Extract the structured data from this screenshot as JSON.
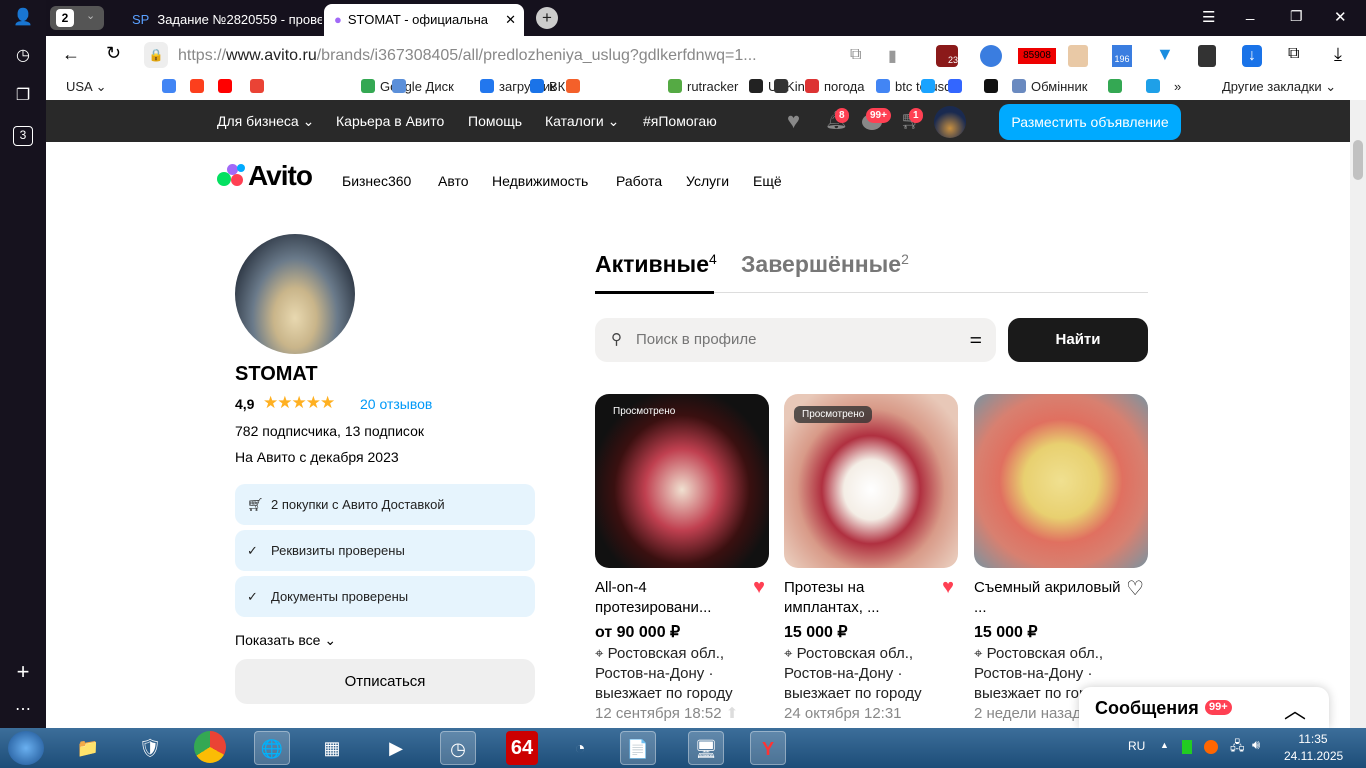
{
  "browser": {
    "tab_count": "2",
    "tabs": [
      {
        "label": "Задание №2820559 - проверка"
      },
      {
        "label": "STOMAT - официальная страница"
      }
    ],
    "url_prefix": "https://",
    "url_domain": "www.avito.ru",
    "url_path": "/brands/i367308405/all/predlozheniya_uslug?gdlkerfdnwq=1...",
    "extension_badges": [
      "23",
      "85908",
      "196"
    ],
    "sidebar_badge": "3",
    "bookmarks": [
      {
        "label": "USA",
        "color": "#fff"
      },
      {
        "label": "",
        "color": "#4285f4"
      },
      {
        "label": "",
        "color": "#fc3f1d"
      },
      {
        "label": "",
        "color": "#ff0000"
      },
      {
        "label": "",
        "color": "#ea4335"
      },
      {
        "label": "Google Диск",
        "color": "#34a853"
      },
      {
        "label": "",
        "color": "#5b8fd9"
      },
      {
        "label": "загрузчик",
        "color": "#2277ee"
      },
      {
        "label": "ВК",
        "color": "#1a73e8"
      },
      {
        "label": "",
        "color": "#f4602a"
      },
      {
        "label": "rutracker",
        "color": "#5a4"
      },
      {
        "label": "UAKino",
        "color": "#222"
      },
      {
        "label": "",
        "color": "#333"
      },
      {
        "label": "погода",
        "color": "#d33"
      },
      {
        "label": "btc to usd",
        "color": "#4285f4"
      },
      {
        "label": "",
        "color": "#1aa3ff"
      },
      {
        "label": "",
        "color": "#3366ff"
      },
      {
        "label": "",
        "color": "#111"
      },
      {
        "label": "Обмінник",
        "color": "#6a8ac0"
      },
      {
        "label": "",
        "color": "#34a853"
      },
      {
        "label": "",
        "color": "#1ea0e8"
      }
    ],
    "more_bookmarks": "»",
    "other_bookmarks": "Другие закладки"
  },
  "avito_header": {
    "nav": [
      "Для бизнеса",
      "Карьера в Авито",
      "Помощь",
      "Каталоги",
      "#яПомогаю"
    ],
    "notifications_badge": "8",
    "messages_badge": "99+",
    "cart_badge": "1",
    "post_button": "Разместить объявление",
    "logo": "Avito",
    "main_nav": [
      "Бизнес360",
      "Авто",
      "Недвижимость",
      "Работа",
      "Услуги",
      "Ещё"
    ],
    "accent": "#00aaff"
  },
  "profile": {
    "name": "STOMAT",
    "rating": "4,9",
    "stars": 5,
    "reviews": "20 отзывов",
    "followers": "782 подписчика, 13 подписок",
    "since": "На Авито с декабря 2023",
    "badges": [
      "2 покупки с Авито Доставкой",
      "Реквизиты проверены",
      "Документы проверены"
    ],
    "show_all": "Показать все",
    "unsubscribe": "Отписаться"
  },
  "listings": {
    "tabs": [
      {
        "label": "Активные",
        "count": "4"
      },
      {
        "label": "Завершённые",
        "count": "2"
      }
    ],
    "search_placeholder": "Поиск в профиле",
    "search_button": "Найти",
    "seen_label": "Просмотрено",
    "items": [
      {
        "title": "All-on-4 протезировани...",
        "price": "от 90 000 ₽",
        "location": "Ростовская обл., Ростов-на-Дону · выезжает по городу",
        "date": "12 сентября 18:52",
        "favorite": true,
        "seen": true
      },
      {
        "title": "Протезы на имплантах, ...",
        "price": "15 000 ₽",
        "location": "Ростовская обл., Ростов-на-Дону · выезжает по городу",
        "date": "24 октября 12:31",
        "favorite": true,
        "seen": true
      },
      {
        "title": "Съемный акриловый ...",
        "price": "15 000 ₽",
        "location": "Ростовская обл., Ростов-на-Дону · выезжает по городу",
        "date": "2 недели назад",
        "favorite": false,
        "seen": false
      }
    ]
  },
  "messages_widget": {
    "label": "Сообщения",
    "badge": "99+"
  },
  "taskbar": {
    "lang": "RU",
    "time": "11:35",
    "date": "24.11.2025",
    "app_64": "64"
  }
}
